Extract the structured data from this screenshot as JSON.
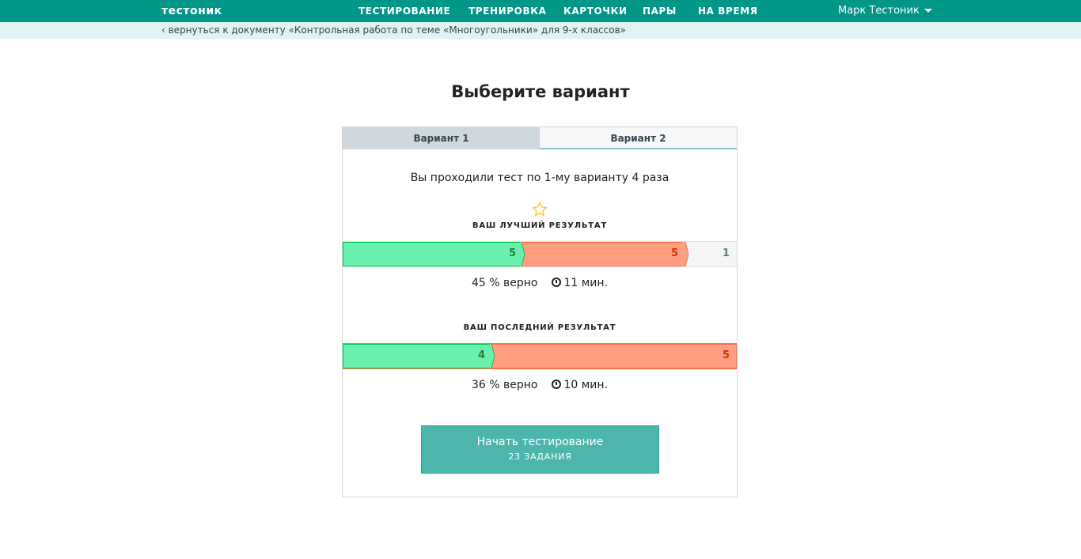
{
  "header": {
    "logo": "тестоник",
    "nav": [
      "ТЕСТИРОВАНИЕ",
      "ТРЕНИРОВКА",
      "КАРТОЧКИ",
      "ПАРЫ",
      "НА ВРЕМЯ"
    ],
    "user_name": "Марк Тестоник"
  },
  "subheader": {
    "back_link": "‹ вернуться к документу «Контрольная работа по теме «Многоугольники» для 9-х классов»"
  },
  "page_title": "Выберите вариант",
  "tabs": [
    "Вариант 1",
    "Вариант 2"
  ],
  "attempts_text": "Вы проходили тест по 1-му варианту 4 раза",
  "best": {
    "label": "ВАШ ЛУЧШИЙ РЕЗУЛЬТАТ",
    "correct": "5",
    "wrong": "5",
    "unanswered": "1",
    "percent": "45 % верно",
    "time": "11 мин."
  },
  "last": {
    "label": "ВАШ ПОСЛЕДНИЙ РЕЗУЛЬТАТ",
    "correct": "4",
    "wrong": "5",
    "percent": "36 % верно",
    "time": "10 мин."
  },
  "start_button": {
    "label": "Начать тестирование",
    "sublabel": "23 ЗАДАНИЯ"
  },
  "colors": {
    "brand": "#009688",
    "correct": "#69f0ae",
    "wrong": "#ff9e80",
    "button": "#4db6ac"
  },
  "icons": [
    "star-icon",
    "clock-icon",
    "caret-down-icon"
  ]
}
